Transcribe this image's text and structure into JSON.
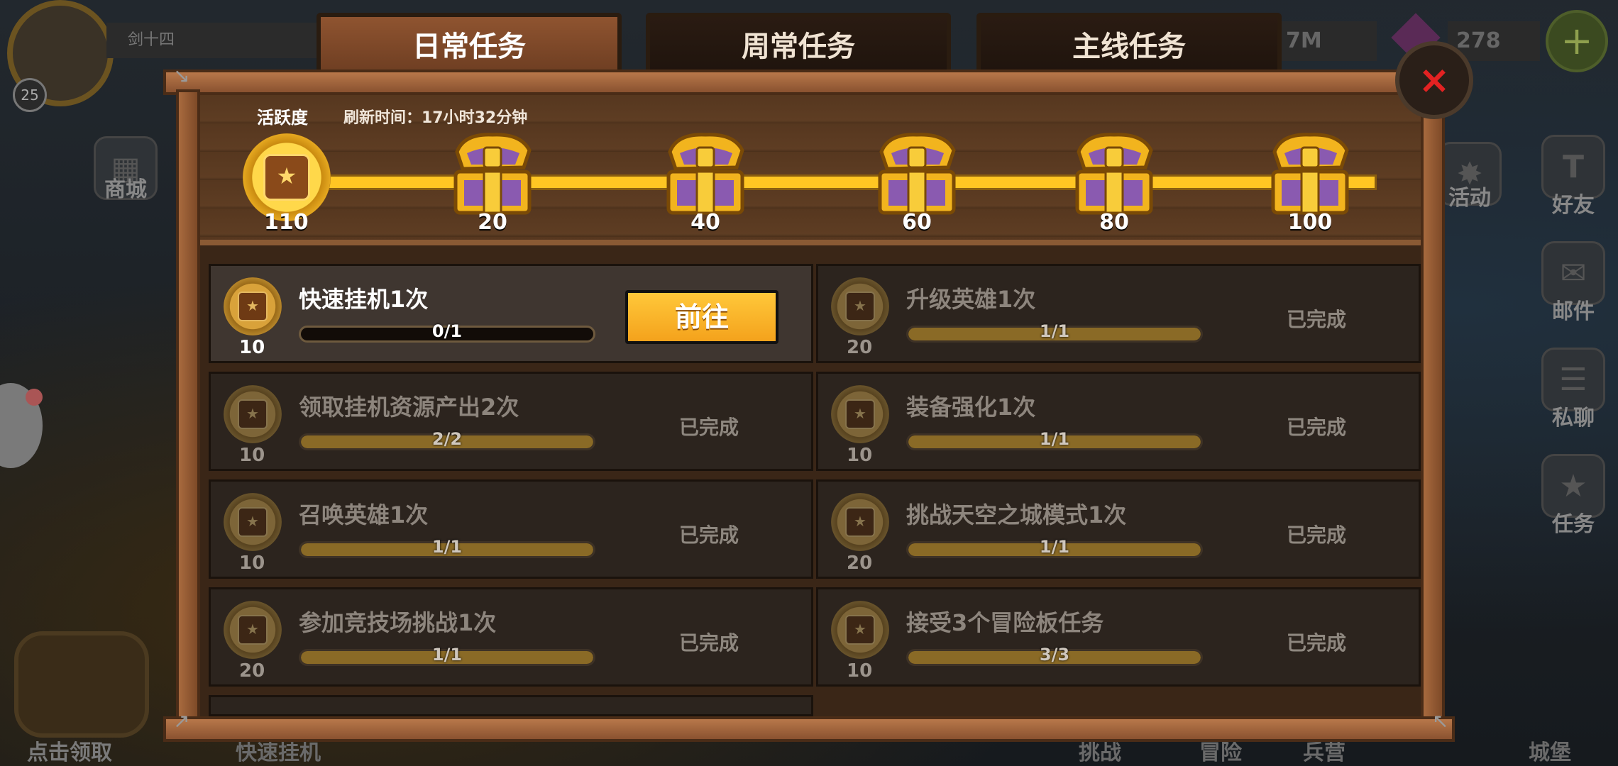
{
  "hud": {
    "player_name": "剑十四",
    "player_level": "25",
    "resource1": "7M",
    "gems": "278",
    "plus": "+",
    "side_left": "商城",
    "side_right": [
      "活动",
      "好友",
      "邮件",
      "私聊",
      "任务"
    ],
    "bottom": [
      "点击领取",
      "快速挂机",
      "挑战",
      "冒险",
      "兵营",
      "城堡"
    ]
  },
  "tabs": [
    {
      "label": "日常任务",
      "active": true
    },
    {
      "label": "周常任务",
      "active": false
    },
    {
      "label": "主线任务",
      "active": false
    }
  ],
  "close_label": "×",
  "activity": {
    "label": "活跃度",
    "refresh": "刷新时间：17小时32分钟",
    "value": "110",
    "milestones": [
      "20",
      "40",
      "60",
      "80",
      "100"
    ]
  },
  "tasks": [
    {
      "title": "快速挂机1次",
      "progress": "0/1",
      "fraction": 0,
      "points": "10",
      "status": "",
      "button": "前往"
    },
    {
      "title": "升级英雄1次",
      "progress": "1/1",
      "fraction": 1,
      "points": "20",
      "status": "已完成"
    },
    {
      "title": "领取挂机资源产出2次",
      "progress": "2/2",
      "fraction": 1,
      "points": "10",
      "status": "已完成"
    },
    {
      "title": "装备强化1次",
      "progress": "1/1",
      "fraction": 1,
      "points": "10",
      "status": "已完成"
    },
    {
      "title": "召唤英雄1次",
      "progress": "1/1",
      "fraction": 1,
      "points": "10",
      "status": "已完成"
    },
    {
      "title": "挑战天空之城模式1次",
      "progress": "1/1",
      "fraction": 1,
      "points": "20",
      "status": "已完成"
    },
    {
      "title": "参加竞技场挑战1次",
      "progress": "1/1",
      "fraction": 1,
      "points": "20",
      "status": "已完成"
    },
    {
      "title": "接受3个冒险板任务",
      "progress": "3/3",
      "fraction": 1,
      "points": "10",
      "status": "已完成"
    }
  ],
  "colors": {
    "accent": "#ffc623",
    "tab_active": "#8f5430",
    "close": "#e32222"
  }
}
